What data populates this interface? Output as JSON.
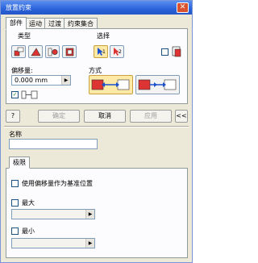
{
  "window": {
    "title": "放置约束",
    "close_glyph": "✕"
  },
  "tabs": [
    "部件",
    "运动",
    "过渡",
    "约束集合"
  ],
  "section": {
    "type_label": "类型",
    "select_label": "选择",
    "select1_label": "1",
    "select2_label": "2",
    "offset_label": "偏移量:",
    "offset_value": "0.000 mm",
    "method_label": "方式"
  },
  "buttons": {
    "help": "?",
    "ok": "确定",
    "cancel": "取消",
    "apply": "应用",
    "collapse": "<<"
  },
  "name": {
    "label": "名称",
    "value": ""
  },
  "limits": {
    "tab_label": "极限",
    "use_offset_label": "使用偏移量作为基准位置",
    "max_label": "最大",
    "min_label": "最小"
  },
  "colors": {
    "title_bar": "#2b63d9",
    "pressed": "#ffe9a6",
    "panel": "#ece9d8"
  }
}
